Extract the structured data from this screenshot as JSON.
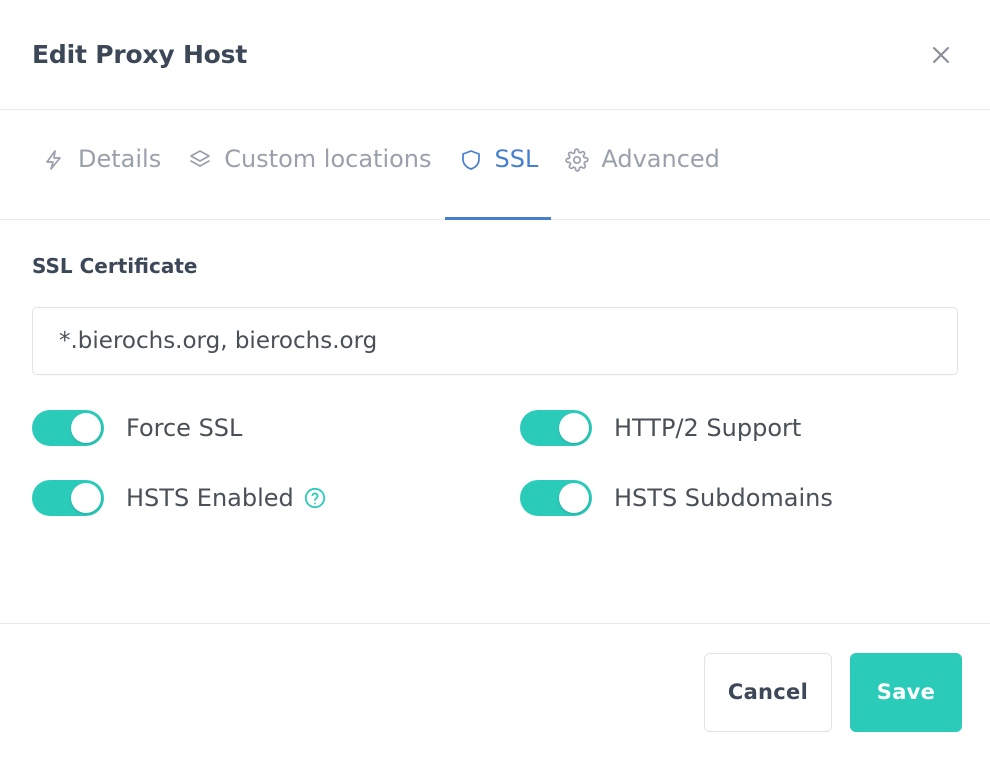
{
  "header": {
    "title": "Edit Proxy Host",
    "close_icon": "close-icon"
  },
  "tabs": [
    {
      "label": "Details",
      "icon": "lightning-bolt-icon",
      "active": false
    },
    {
      "label": "Custom locations",
      "icon": "layers-icon",
      "active": false
    },
    {
      "label": "SSL",
      "icon": "shield-icon",
      "active": true
    },
    {
      "label": "Advanced",
      "icon": "gear-icon",
      "active": false
    }
  ],
  "main": {
    "ssl_certificate_label": "SSL Certificate",
    "ssl_certificate_value": "*.bierochs.org, bierochs.org",
    "toggles": [
      {
        "label": "Force SSL",
        "on": true,
        "help": false
      },
      {
        "label": "HTTP/2 Support",
        "on": true,
        "help": false
      },
      {
        "label": "HSTS Enabled",
        "on": true,
        "help": true
      },
      {
        "label": "HSTS Subdomains",
        "on": true,
        "help": false
      }
    ]
  },
  "footer": {
    "cancel_label": "Cancel",
    "save_label": "Save"
  },
  "colors": {
    "accent_teal": "#2bcbba",
    "accent_blue": "#467fcf",
    "text_dark": "#3c4858",
    "text_muted": "#9aa0ac",
    "border": "#e7ebf0"
  }
}
